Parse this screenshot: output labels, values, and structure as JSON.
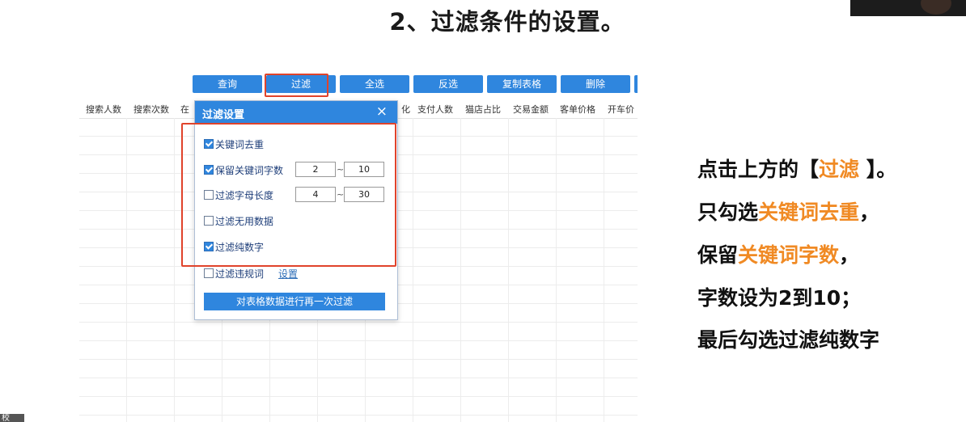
{
  "slide": {
    "title": "2、过滤条件的设置。"
  },
  "toolbar": {
    "buttons": [
      "查询",
      "过滤",
      "全选",
      "反选",
      "复制表格",
      "删除"
    ]
  },
  "grid": {
    "headers_left": [
      "搜索人数",
      "搜索次数",
      "在"
    ],
    "headers_right": [
      "化",
      "支付人数",
      "猫店占比",
      "交易金额",
      "客单价格",
      "开车价"
    ]
  },
  "dialog": {
    "title": "过滤设置",
    "close": "×",
    "options": [
      {
        "label": "关键词去重",
        "checked": true
      },
      {
        "label": "保留关键词字数",
        "checked": true,
        "min": "2",
        "max": "10"
      },
      {
        "label": "过滤字母长度",
        "checked": false,
        "min": "4",
        "max": "30"
      },
      {
        "label": "过滤无用数据",
        "checked": false
      },
      {
        "label": "过滤纯数字",
        "checked": true
      },
      {
        "label": "过滤违规词",
        "checked": false,
        "link": "设置"
      }
    ],
    "range_sep": "~",
    "action_button": "对表格数据进行再一次过滤"
  },
  "notes": {
    "line1_a": "点击上方的【",
    "line1_b": "过滤",
    "line1_c": " 】。",
    "line2_a": "只勾选",
    "line2_b": "关键词去重",
    "line2_c": "，",
    "line3_a": "保留",
    "line3_b": "关键词字数",
    "line3_c": "，",
    "line4": "字数设为2到10；",
    "line5": "最后勾选过滤纯数字"
  },
  "corner": {
    "label": "校"
  },
  "colors": {
    "accent": "#f08a24",
    "button_blue": "#2f86de",
    "highlight_red": "#e0432b"
  }
}
